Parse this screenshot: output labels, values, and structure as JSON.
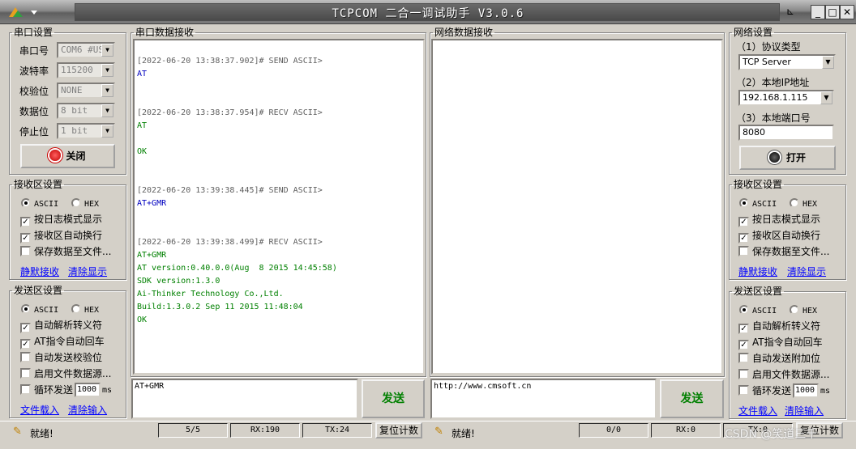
{
  "window": {
    "title": "TCPCOM 二合一调试助手  V3.0.6",
    "pin": "⊾",
    "minimize": "_",
    "maximize": "□",
    "close": "✕"
  },
  "serial_settings": {
    "legend": "串口设置",
    "port_label": "串口号",
    "port_value": "COM6 #US",
    "baud_label": "波特率",
    "baud_value": "115200",
    "parity_label": "校验位",
    "parity_value": "NONE",
    "databits_label": "数据位",
    "databits_value": "8 bit",
    "stopbits_label": "停止位",
    "stopbits_value": "1 bit",
    "close_button": "关闭"
  },
  "left_recv_settings": {
    "legend": "接收区设置",
    "ascii": "ASCII",
    "hex": "HEX",
    "log_mode": "按日志模式显示",
    "auto_wrap": "接收区自动换行",
    "save_to_file": "保存数据至文件...",
    "silent_recv": "静默接收",
    "clear_display": "清除显示"
  },
  "left_send_settings": {
    "legend": "发送区设置",
    "ascii": "ASCII",
    "hex": "HEX",
    "auto_escape": "自动解析转义符",
    "at_auto_cr": "AT指令自动回车",
    "auto_checksum": "自动发送校验位",
    "file_source": "启用文件数据源...",
    "loop_send": "循环发送",
    "loop_interval": "1000",
    "ms": "ms",
    "load_file": "文件载入",
    "clear_input": "清除输入"
  },
  "serial_recv": {
    "legend": "串口数据接收",
    "lines": [
      {
        "text": "[2022-06-20 13:38:37.902]# SEND ASCII>",
        "color": "#606060"
      },
      {
        "text": "AT",
        "color": "#0000c0"
      },
      {
        "text": "[2022-06-20 13:38:37.954]# RECV ASCII>",
        "color": "#606060"
      },
      {
        "text": "AT",
        "color": "#008000"
      },
      {
        "text": "OK",
        "color": "#008000"
      },
      {
        "text": "[2022-06-20 13:39:38.445]# SEND ASCII>",
        "color": "#606060"
      },
      {
        "text": "AT+GMR",
        "color": "#0000c0"
      },
      {
        "text": "[2022-06-20 13:39:38.499]# RECV ASCII>",
        "color": "#606060"
      },
      {
        "text": "AT+GMR",
        "color": "#008000"
      },
      {
        "text": "AT version:0.40.0.0(Aug  8 2015 14:45:58)",
        "color": "#008000"
      },
      {
        "text": "SDK version:1.3.0",
        "color": "#008000"
      },
      {
        "text": "Ai-Thinker Technology Co.,Ltd.",
        "color": "#008000"
      },
      {
        "text": "Build:1.3.0.2 Sep 11 2015 11:48:04",
        "color": "#008000"
      },
      {
        "text": "OK",
        "color": "#008000"
      }
    ]
  },
  "network_recv": {
    "legend": "网络数据接收"
  },
  "serial_send": {
    "input_value": "AT+GMR",
    "send_button": "发送"
  },
  "network_send": {
    "input_value": "http://www.cmsoft.cn",
    "send_button": "发送"
  },
  "network_settings": {
    "legend": "网络设置",
    "protocol_label": "（1）协议类型",
    "protocol_value": "TCP Server",
    "ip_label": "（2）本地IP地址",
    "ip_value": "192.168.1.115",
    "port_label": "（3）本地端口号",
    "port_value": "8080",
    "open_button": "打开"
  },
  "right_recv_settings": {
    "legend": "接收区设置",
    "ascii": "ASCII",
    "hex": "HEX",
    "log_mode": "按日志模式显示",
    "auto_wrap": "接收区自动换行",
    "save_to_file": "保存数据至文件...",
    "silent_recv": "静默接收",
    "clear_display": "清除显示"
  },
  "right_send_settings": {
    "legend": "发送区设置",
    "ascii": "ASCII",
    "hex": "HEX",
    "auto_escape": "自动解析转义符",
    "at_auto_cr": "AT指令自动回车",
    "auto_append": "自动发送附加位",
    "file_source": "启用文件数据源...",
    "loop_send": "循环发送",
    "loop_interval": "1000",
    "ms": "ms",
    "load_file": "文件载入",
    "clear_input": "清除输入"
  },
  "status_left": {
    "ready": "就绪!",
    "count": "5/5",
    "rx": "RX:190",
    "tx": "TX:24",
    "reset": "复位计数"
  },
  "status_right": {
    "ready": "就绪!",
    "count": "0/0",
    "rx": "RX:0",
    "tx": "TX:0",
    "reset": "复位计数"
  },
  "watermark": "CSDN @笑道三千"
}
